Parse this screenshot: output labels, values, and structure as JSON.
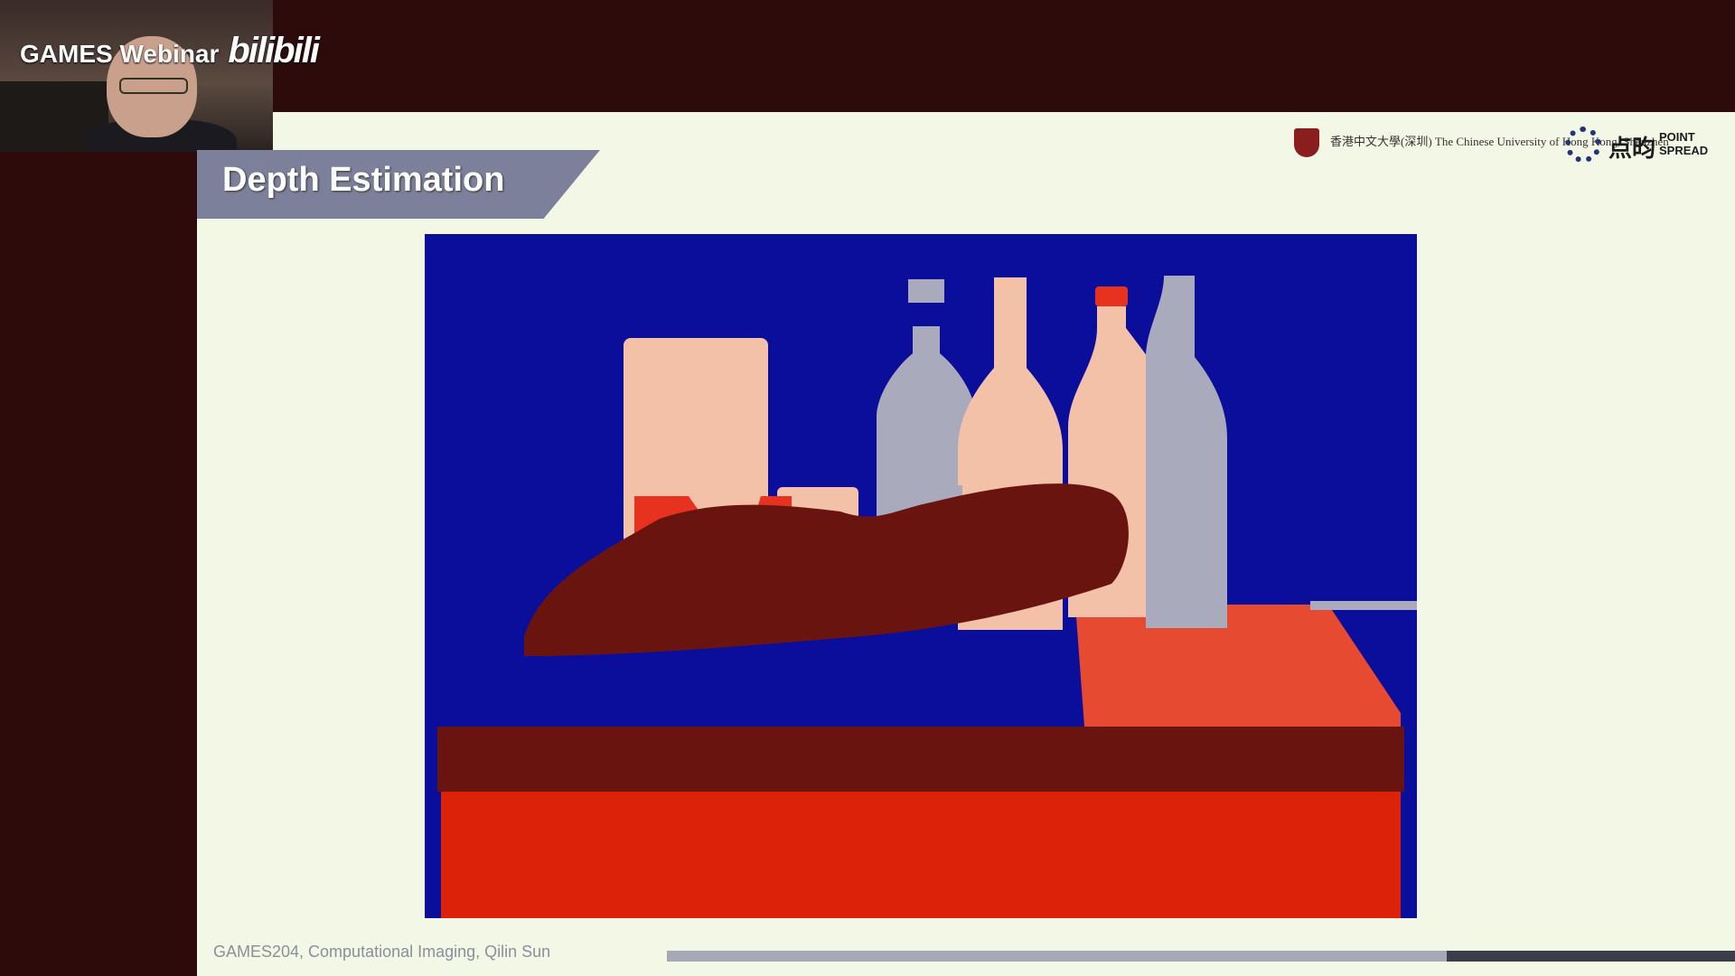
{
  "overlay": {
    "stream_label": "GAMES Webinar",
    "platform_label": "bilibili"
  },
  "slide": {
    "title": "Depth Estimation",
    "footer": "GAMES204, Computational Imaging, Qilin Sun",
    "progress_fraction": 0.73
  },
  "logos": {
    "cuhk_name": "香港中文大學(深圳) The Chinese University of Hong Kong, Shenzhen",
    "pointspread_cn": "点昀",
    "pointspread_en_1": "POINT",
    "pointspread_en_2": "SPREAD"
  },
  "colors": {
    "frame_bg": "#2d0b0b",
    "slide_bg": "#f3f8e6",
    "title_band": "#7c809a",
    "depth_far": "#0a0e9a",
    "depth_mid_light": "#f3c0a8",
    "depth_mid_gray": "#a9abbd",
    "depth_near_red": "#e6321e",
    "depth_nearest": "#6a1410",
    "depth_floor": "#dc2208"
  },
  "icons": [
    "webcam-feed",
    "cuhk-crest-icon",
    "pointspread-logo-icon"
  ]
}
